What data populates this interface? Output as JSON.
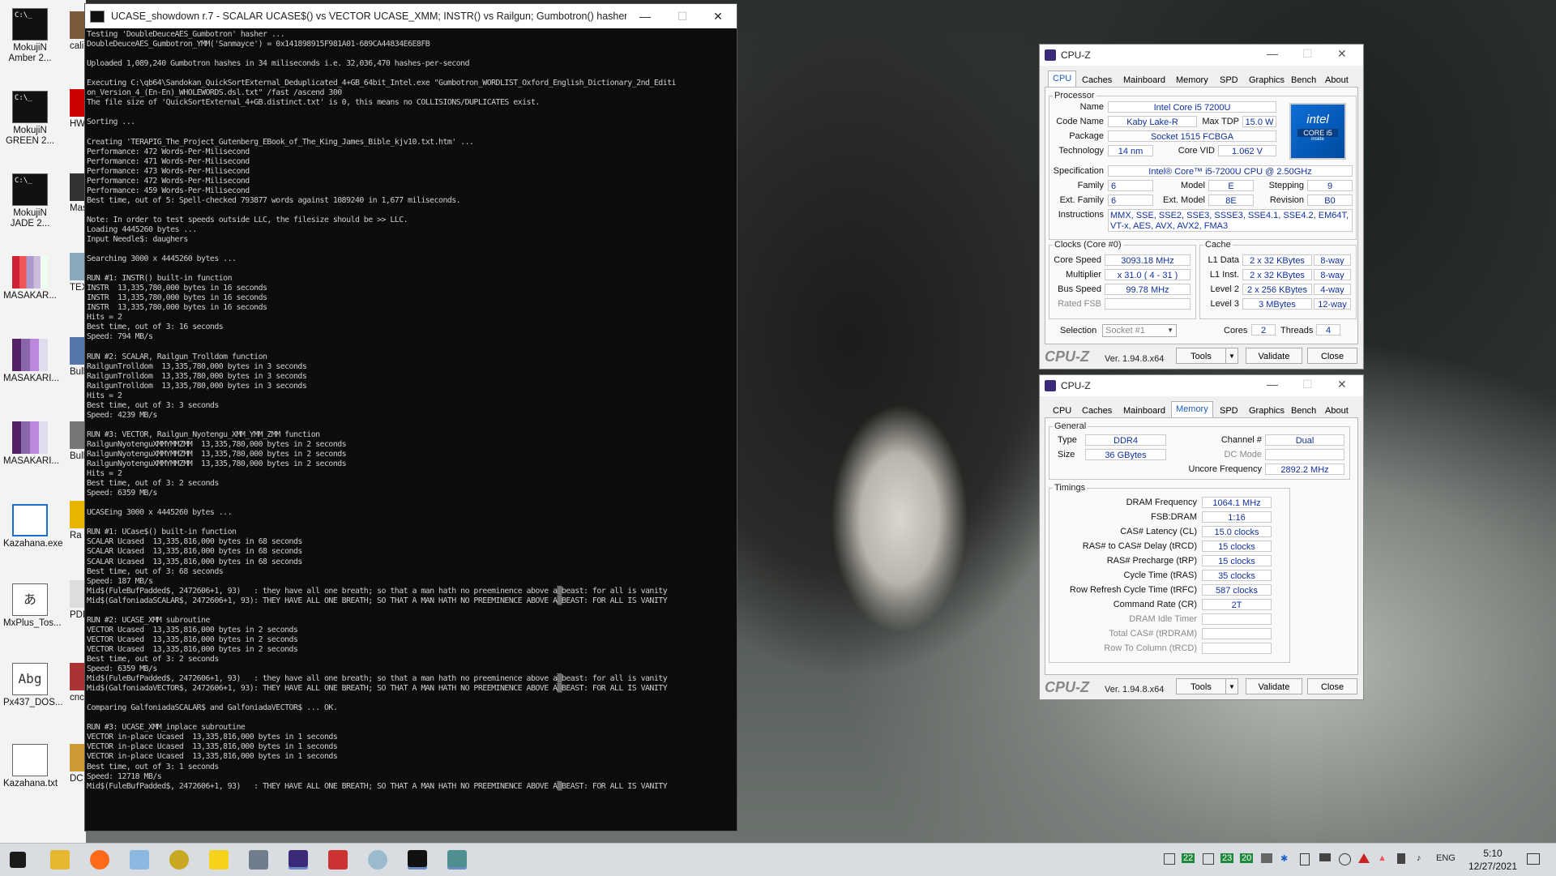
{
  "console": {
    "title": "UCASE_showdown r.7 - SCALAR UCASE$() vs VECTOR UCASE_XMM; INSTR() vs Railgun; Gumbotron() hasher; Binary-Sea...",
    "lines": [
      "Testing 'DoubleDeuceAES_Gumbotron' hasher ...",
      "DoubleDeuceAES_Gumbotron_YMM('Sanmayce') = 0x141898915F981A01-689CA44834E6E8FB",
      "",
      "Uploaded 1,089,240 Gumbotron hashes in 34 miliseconds i.e. 32,036,470 hashes-per-second",
      "",
      "Executing C:\\qb64\\Sandokan_QuickSortExternal_Deduplicated_4+GB_64bit_Intel.exe \"Gumbotron_WORDLIST_Oxford_English_Dictionary_2nd_Editi",
      "on_Version_4_(En-En)_WHOLEWORDS.dsl.txt\" /fast /ascend 300",
      "The file size of 'QuickSortExternal_4+GB.distinct.txt' is 0, this means no COLLISIONS/DUPLICATES exist.",
      "",
      "Sorting ...",
      "",
      "Creating 'TERAPIG_The_Project_Gutenberg_EBook_of_The_King_James_Bible_kjv10.txt.htm' ...",
      "Performance: 472 Words-Per-Milisecond",
      "Performance: 471 Words-Per-Milisecond",
      "Performance: 473 Words-Per-Milisecond",
      "Performance: 472 Words-Per-Milisecond",
      "Performance: 459 Words-Per-Milisecond",
      "Best time, out of 5: Spell-checked 793877 words against 1089240 in 1,677 miliseconds.",
      "",
      "Note: In order to test speeds outside LLC, the filesize should be >> LLC.",
      "Loading 4445260 bytes ...",
      "Input Needle$: daughers",
      "",
      "Searching 3000 x 4445260 bytes ...",
      "",
      "RUN #1: INSTR() built-in function",
      "INSTR  13,335,780,000 bytes in 16 seconds",
      "INSTR  13,335,780,000 bytes in 16 seconds",
      "INSTR  13,335,780,000 bytes in 16 seconds",
      "Hits = 2",
      "Best time, out of 3: 16 seconds",
      "Speed: 794 MB/s",
      "",
      "RUN #2: SCALAR, Railgun_Trolldom function",
      "RailgunTrolldom  13,335,780,000 bytes in 3 seconds",
      "RailgunTrolldom  13,335,780,000 bytes in 3 seconds",
      "RailgunTrolldom  13,335,780,000 bytes in 3 seconds",
      "Hits = 2",
      "Best time, out of 3: 3 seconds",
      "Speed: 4239 MB/s",
      "",
      "RUN #3: VECTOR, Railgun_Nyotengu_XMM_YMM_ZMM function",
      "RailgunNyotenguXMMYMMZMM  13,335,780,000 bytes in 2 seconds",
      "RailgunNyotenguXMMYMMZMM  13,335,780,000 bytes in 2 seconds",
      "RailgunNyotenguXMMYMMZMM  13,335,780,000 bytes in 2 seconds",
      "Hits = 2",
      "Best time, out of 3: 2 seconds",
      "Speed: 6359 MB/s",
      "",
      "UCASEing 3000 x 4445260 bytes ...",
      "",
      "RUN #1: UCase$() built-in function",
      "SCALAR Ucased  13,335,816,000 bytes in 68 seconds",
      "SCALAR Ucased  13,335,816,000 bytes in 68 seconds",
      "SCALAR Ucased  13,335,816,000 bytes in 68 seconds",
      "Best time, out of 3: 68 seconds",
      "Speed: 187 MB/s",
      "Mid$(FuleBufPadded$, 2472606+1, 93)   : they have all one breath; so that a man hath no preeminence above a▒beast: for all is vanity",
      "Mid$(GalfoniadaSCALAR$, 2472606+1, 93): THEY HAVE ALL ONE BREATH; SO THAT A MAN HATH NO PREEMINENCE ABOVE A▒BEAST: FOR ALL IS VANITY",
      "",
      "RUN #2: UCASE_XMM subroutine",
      "VECTOR Ucased  13,335,816,000 bytes in 2 seconds",
      "VECTOR Ucased  13,335,816,000 bytes in 2 seconds",
      "VECTOR Ucased  13,335,816,000 bytes in 2 seconds",
      "Best time, out of 3: 2 seconds",
      "Speed: 6359 MB/s",
      "Mid$(FuleBufPadded$, 2472606+1, 93)   : they have all one breath; so that a man hath no preeminence above a▒beast: for all is vanity",
      "Mid$(GalfoniadaVECTOR$, 2472606+1, 93): THEY HAVE ALL ONE BREATH; SO THAT A MAN HATH NO PREEMINENCE ABOVE A▒BEAST: FOR ALL IS VANITY",
      "",
      "Comparing GalfoniadaSCALAR$ and GalfoniadaVECTOR$ ... OK.",
      "",
      "RUN #3: UCASE_XMM_inplace subroutine",
      "VECTOR in-place Ucased  13,335,816,000 bytes in 1 seconds",
      "VECTOR in-place Ucased  13,335,816,000 bytes in 1 seconds",
      "VECTOR in-place Ucased  13,335,816,000 bytes in 1 seconds",
      "Best time, out of 3: 1 seconds",
      "Speed: 12718 MB/s",
      "Mid$(FuleBufPadded$, 2472606+1, 93)   : THEY HAVE ALL ONE BREATH; SO THAT A MAN HATH NO PREEMINENCE ABOVE A▒BEAST: FOR ALL IS VANITY",
      "",
      "",
      "",
      "",
      "Press any key to continue"
    ]
  },
  "desktop": {
    "icons": [
      "MokujiN Amber 2...",
      "MokujiN GREEN 2...",
      "MokujiN JADE 2...",
      "MASAKAR...",
      "MASAKARI...",
      "MASAKARI...",
      "Kazahana.exe",
      "MxPlus_Tos...",
      "Px437_DOS...",
      "Kazahana.txt"
    ],
    "icon_glyphs": {
      "cmd": "C:\\_",
      "fontA": "あ",
      "fontB": "Abg"
    },
    "icons2": [
      "calib E-bo",
      "HWi",
      "Masa",
      "TEX Sh",
      "Bulk Uti",
      "Bulk Uti",
      "Ra Conf",
      "PDFM Co",
      "cnc3 - Sh",
      "DC O"
    ]
  },
  "cpuz_top": {
    "title": "CPU-Z",
    "tabs": [
      "CPU",
      "Caches",
      "Mainboard",
      "Memory",
      "SPD",
      "Graphics",
      "Bench",
      "About"
    ],
    "active_tab": "CPU",
    "processor": {
      "group": "Processor",
      "name_label": "Name",
      "name": "Intel Core i5 7200U",
      "codename_label": "Code Name",
      "codename": "Kaby Lake-R",
      "maxtdp_label": "Max TDP",
      "maxtdp": "15.0 W",
      "package_label": "Package",
      "package": "Socket 1515 FCBGA",
      "tech_label": "Technology",
      "tech": "14 nm",
      "corevid_label": "Core VID",
      "corevid": "1.062 V",
      "spec_label": "Specification",
      "spec": "Intel® Core™ i5-7200U CPU @ 2.50GHz",
      "family_label": "Family",
      "family": "6",
      "model_label": "Model",
      "model": "E",
      "stepping_label": "Stepping",
      "stepping": "9",
      "extfamily_label": "Ext. Family",
      "extfamily": "6",
      "extmodel_label": "Ext. Model",
      "extmodel": "8E",
      "revision_label": "Revision",
      "revision": "B0",
      "instr_label": "Instructions",
      "instr": "MMX, SSE, SSE2, SSE3, SSSE3, SSE4.1, SSE4.2, EM64T, VT-x, AES, AVX, AVX2, FMA3",
      "logo": {
        "brand": "intel",
        "line": "CORE i5",
        "tag": "inside"
      }
    },
    "clocks": {
      "group": "Clocks (Core #0)",
      "corespeed_label": "Core Speed",
      "corespeed": "3093.18 MHz",
      "mult_label": "Multiplier",
      "mult": "x 31.0 ( 4 - 31 )",
      "bus_label": "Bus Speed",
      "bus": "99.78 MHz",
      "fsb_label": "Rated FSB",
      "fsb": ""
    },
    "cache": {
      "group": "Cache",
      "l1d_label": "L1 Data",
      "l1d": "2 x 32 KBytes",
      "l1d_way": "8-way",
      "l1i_label": "L1 Inst.",
      "l1i": "2 x 32 KBytes",
      "l1i_way": "8-way",
      "l2_label": "Level 2",
      "l2": "2 x 256 KBytes",
      "l2_way": "4-way",
      "l3_label": "Level 3",
      "l3": "3 MBytes",
      "l3_way": "12-way"
    },
    "selection_label": "Selection",
    "selection": "Socket #1",
    "cores_label": "Cores",
    "cores": "2",
    "threads_label": "Threads",
    "threads": "4"
  },
  "cpuz_bottom": {
    "title": "CPU-Z",
    "active_tab": "Memory",
    "general": {
      "group": "General",
      "type_label": "Type",
      "type": "DDR4",
      "size_label": "Size",
      "size": "36 GBytes",
      "channel_label": "Channel #",
      "channel": "Dual",
      "dcmode_label": "DC Mode",
      "dcmode": "",
      "uncore_label": "Uncore Frequency",
      "uncore": "2892.2 MHz"
    },
    "timings": {
      "group": "Timings",
      "rows": [
        {
          "label": "DRAM Frequency",
          "value": "1064.1 MHz",
          "dim": false
        },
        {
          "label": "FSB:DRAM",
          "value": "1:16",
          "dim": false
        },
        {
          "label": "CAS# Latency (CL)",
          "value": "15.0 clocks",
          "dim": false
        },
        {
          "label": "RAS# to CAS# Delay (tRCD)",
          "value": "15 clocks",
          "dim": false
        },
        {
          "label": "RAS# Precharge (tRP)",
          "value": "15 clocks",
          "dim": false
        },
        {
          "label": "Cycle Time (tRAS)",
          "value": "35 clocks",
          "dim": false
        },
        {
          "label": "Row Refresh Cycle Time (tRFC)",
          "value": "587 clocks",
          "dim": false
        },
        {
          "label": "Command Rate (CR)",
          "value": "2T",
          "dim": false
        },
        {
          "label": "DRAM Idle Timer",
          "value": "",
          "dim": true
        },
        {
          "label": "Total CAS# (tRDRAM)",
          "value": "",
          "dim": true
        },
        {
          "label": "Row To Column (tRCD)",
          "value": "",
          "dim": true
        }
      ]
    }
  },
  "cpuz_footer": {
    "brand": "CPU-Z",
    "version": "Ver. 1.94.8.x64",
    "tools": "Tools",
    "validate": "Validate",
    "close": "Close"
  },
  "taskbar": {
    "tray_text": "ENG",
    "tray_nums": [
      "22",
      "23",
      "20"
    ],
    "time": "5:10",
    "date": "12/27/2021"
  }
}
